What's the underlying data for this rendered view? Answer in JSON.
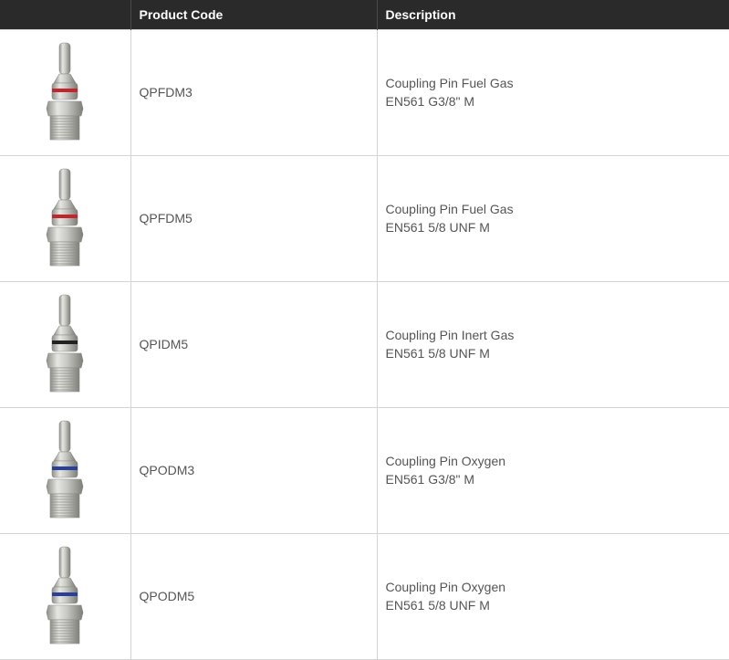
{
  "table": {
    "headers": {
      "image": "",
      "code": "Product Code",
      "description": "Description"
    },
    "rows": [
      {
        "code": "QPFDM3",
        "desc_line1": "Coupling Pin Fuel Gas",
        "desc_line2": "EN561 G3/8\" M",
        "ring_color": "#c0262b",
        "thread": "G3/8"
      },
      {
        "code": "QPFDM5",
        "desc_line1": "Coupling Pin Fuel Gas",
        "desc_line2": "EN561 5/8 UNF M",
        "ring_color": "#c0262b",
        "thread": "5/8 UNF"
      },
      {
        "code": "QPIDM5",
        "desc_line1": "Coupling Pin Inert Gas",
        "desc_line2": "EN561 5/8 UNF M",
        "ring_color": "#222222",
        "thread": "5/8 UNF"
      },
      {
        "code": "QPODM3",
        "desc_line1": "Coupling Pin Oxygen",
        "desc_line2": "EN561 G3/8\" M",
        "ring_color": "#2a3f9a",
        "thread": "G3/8"
      },
      {
        "code": "QPODM5",
        "desc_line1": "Coupling Pin Oxygen",
        "desc_line2": "EN561 5/8 UNF M",
        "ring_color": "#2a3f9a",
        "thread": "5/8 UNF"
      }
    ]
  }
}
